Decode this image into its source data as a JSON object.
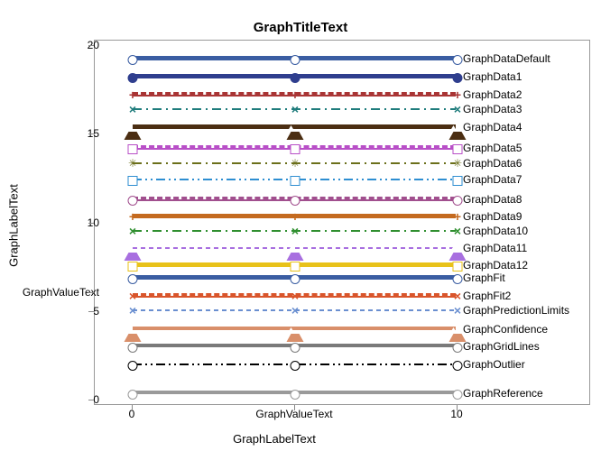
{
  "chart_data": {
    "type": "line",
    "title": "GraphTitleText",
    "xlabel": "GraphLabelText",
    "ylabel": "GraphLabelText",
    "xlim": [
      0,
      10
    ],
    "ylim": [
      0,
      20
    ],
    "x_ticks": [
      {
        "value": 0,
        "label": "0"
      },
      {
        "value": 5,
        "label": "GraphValueText"
      },
      {
        "value": 10,
        "label": "10"
      }
    ],
    "y_ticks": [
      {
        "value": 0,
        "label": "0"
      },
      {
        "value": 5,
        "label": "5"
      },
      {
        "value": 6.05,
        "label": "GraphValueText"
      },
      {
        "value": 10,
        "label": "10"
      },
      {
        "value": 15,
        "label": "15"
      },
      {
        "value": 20,
        "label": "20"
      }
    ],
    "x": [
      0,
      5,
      10
    ],
    "series": [
      {
        "name": "GraphDataDefault",
        "y": 19.45,
        "color": "#3A5DA2",
        "line": "solid",
        "thin": false,
        "marker": "circle"
      },
      {
        "name": "GraphData1",
        "y": 18.4,
        "color": "#2F3E8E",
        "line": "solid",
        "thin": false,
        "marker": "circle-filled"
      },
      {
        "name": "GraphData2",
        "y": 17.4,
        "color": "#A93535",
        "line": "dash",
        "thin": false,
        "marker": "plus"
      },
      {
        "name": "GraphData3",
        "y": 16.45,
        "color": "#1F7C7C",
        "line": "dashdot",
        "thin": false,
        "marker": "x"
      },
      {
        "name": "GraphData4",
        "y": 15.55,
        "color": "#4B2E12",
        "line": "solid",
        "thin": false,
        "marker": "triangle"
      },
      {
        "name": "GraphData5",
        "y": 14.4,
        "color": "#B84FC7",
        "line": "dash",
        "thin": false,
        "marker": "square"
      },
      {
        "name": "GraphData6",
        "y": 13.4,
        "color": "#6B6F1A",
        "line": "dashdot",
        "thin": false,
        "marker": "asterisk"
      },
      {
        "name": "GraphData7",
        "y": 12.45,
        "color": "#2E8ED1",
        "line": "dashdotdot",
        "thin": false,
        "marker": "diamond"
      },
      {
        "name": "GraphData8",
        "y": 11.5,
        "color": "#A14F8E",
        "line": "dash",
        "thin": false,
        "marker": "circle"
      },
      {
        "name": "GraphData9",
        "y": 10.55,
        "color": "#C46A1F",
        "line": "solid",
        "thin": false,
        "marker": "plus"
      },
      {
        "name": "GraphData10",
        "y": 9.55,
        "color": "#2F8F2F",
        "line": "dashdot",
        "thin": false,
        "marker": "x"
      },
      {
        "name": "GraphData11",
        "y": 8.6,
        "color": "#A86FE0",
        "line": "shortdash",
        "thin": false,
        "marker": "triangle"
      },
      {
        "name": "GraphData12",
        "y": 7.8,
        "color": "#E8C21A",
        "line": "solid",
        "thin": false,
        "marker": "square"
      },
      {
        "name": "GraphFit",
        "y": 7.05,
        "color": "#3A5DA2",
        "line": "solid",
        "thin": false,
        "marker": "circle"
      },
      {
        "name": "GraphFit2",
        "y": 6.05,
        "color": "#D9552B",
        "line": "dash",
        "thin": false,
        "marker": "x"
      },
      {
        "name": "GraphPredictionLimits",
        "y": 5.1,
        "color": "#6A8FD0",
        "line": "shortdash",
        "thin": true,
        "marker": "x"
      },
      {
        "name": "GraphConfidence",
        "y": 4.15,
        "color": "#D98F6A",
        "line": "solid",
        "thin": true,
        "marker": "triangle"
      },
      {
        "name": "GraphGridLines",
        "y": 3.2,
        "color": "#7A7A7A",
        "line": "solid",
        "thin": true,
        "marker": "circle"
      },
      {
        "name": "GraphOutlier",
        "y": 2.05,
        "color": "#000000",
        "line": "dashdotdot",
        "thin": false,
        "marker": "circle"
      },
      {
        "name": "GraphReference",
        "y": 0.55,
        "color": "#9A9A9A",
        "line": "solid",
        "thin": true,
        "marker": "circle"
      }
    ]
  }
}
